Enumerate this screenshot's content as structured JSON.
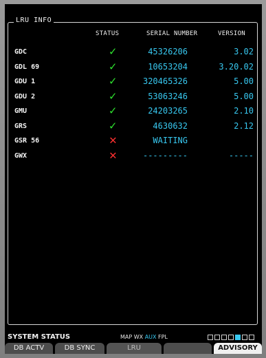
{
  "box_title": "LRU INFO",
  "columns": {
    "status": "STATUS",
    "serial": "SERIAL NUMBER",
    "version": "VERSION"
  },
  "rows": [
    {
      "name": "GDC",
      "status": "ok",
      "serial": "45326206",
      "version": "3.02"
    },
    {
      "name": "GDL 69",
      "status": "ok",
      "serial": "10653204",
      "version": "3.20.02"
    },
    {
      "name": "GDU 1",
      "status": "ok",
      "serial": "320465326",
      "version": "5.00"
    },
    {
      "name": "GDU 2",
      "status": "ok",
      "serial": "53063246",
      "version": "5.00"
    },
    {
      "name": "GMU",
      "status": "ok",
      "serial": "24203265",
      "version": "2.10"
    },
    {
      "name": "GRS",
      "status": "ok",
      "serial": "4630632",
      "version": "2.12"
    },
    {
      "name": "GSR 56",
      "status": "fail",
      "serial": "WAITING",
      "version": ""
    },
    {
      "name": "GWX",
      "status": "fail",
      "serial": "---------",
      "version": "-----"
    }
  ],
  "status_icons": {
    "ok": "check-icon",
    "fail": "cross-icon"
  },
  "colors": {
    "value": "#38c8f0",
    "ok": "#2ee02e",
    "fail": "#ff3030"
  },
  "footer": {
    "page_title": "SYSTEM STATUS",
    "page_groups": [
      "MAP",
      "WX",
      "AUX",
      "FPL"
    ],
    "active_group": "AUX",
    "page_count": 7,
    "active_page": 5
  },
  "softkeys": [
    {
      "label": "DB ACTV",
      "state": "normal"
    },
    {
      "label": "DB SYNC",
      "state": "normal"
    },
    {
      "label": "LRU",
      "state": "dim"
    },
    {
      "label": "",
      "state": "normal"
    },
    {
      "label": "ADVISORY",
      "state": "active"
    }
  ]
}
